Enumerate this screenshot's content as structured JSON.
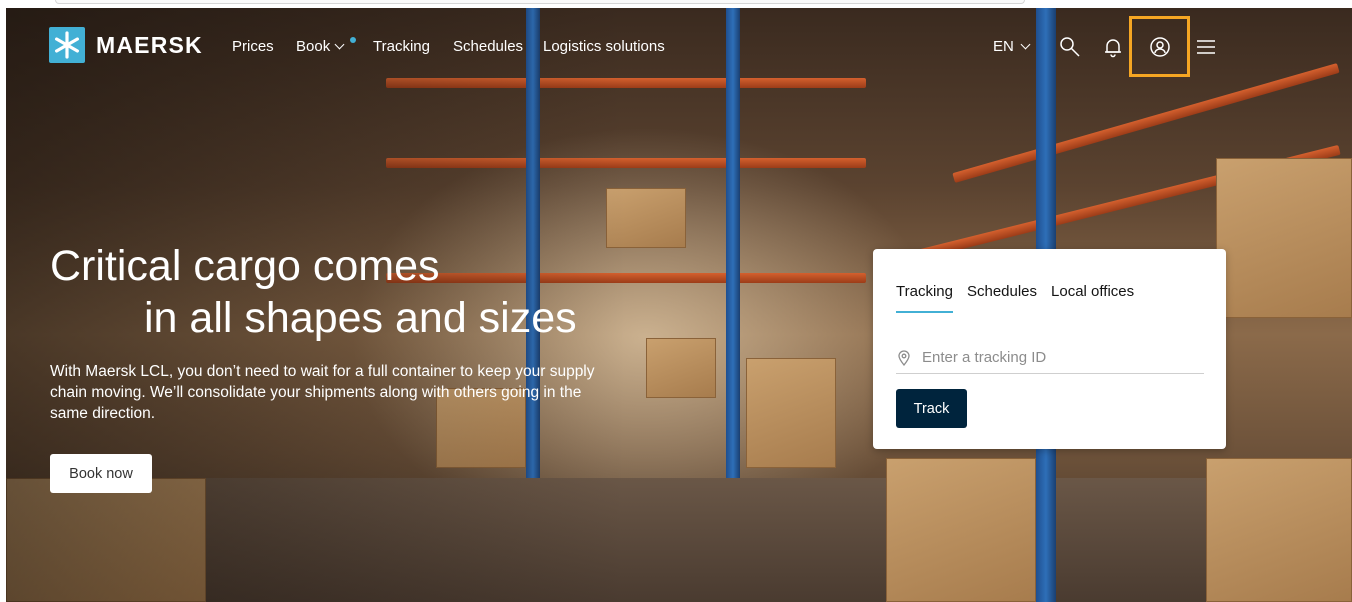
{
  "nav": {
    "brand": "MAERSK",
    "links": [
      "Prices",
      "Book",
      "Tracking",
      "Schedules",
      "Logistics solutions"
    ],
    "language": "EN",
    "icons": [
      "search-icon",
      "bell-icon",
      "user-account-icon",
      "hamburger-menu-icon"
    ]
  },
  "hero": {
    "headline_line1": "Critical cargo comes",
    "headline_line2": "in all shapes and sizes",
    "subtext": "With Maersk LCL, you don’t need to wait for a full container to keep your supply chain moving. We’ll consolidate your shipments along with others going in the same direction.",
    "cta": "Book now"
  },
  "widget": {
    "tabs": [
      "Tracking",
      "Schedules",
      "Local offices"
    ],
    "active_tab": "Tracking",
    "input_placeholder": "Enter a tracking ID",
    "input_value": "",
    "button": "Track"
  },
  "colors": {
    "brand_blue": "#42b0d5",
    "dark_navy": "#00243d",
    "highlight": "#f5a623",
    "white": "#ffffff"
  }
}
